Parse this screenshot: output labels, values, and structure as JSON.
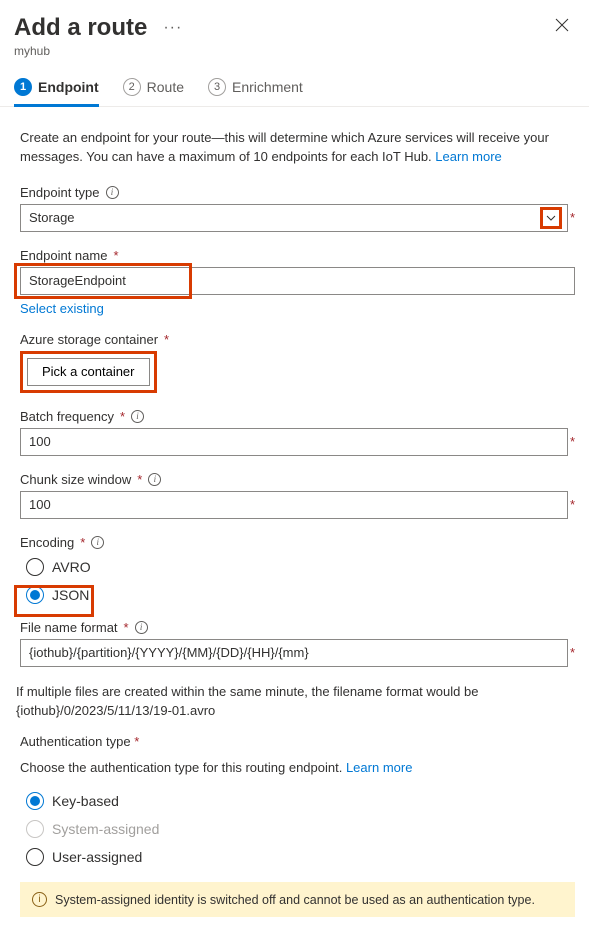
{
  "header": {
    "title": "Add a route",
    "subtitle": "myhub"
  },
  "stepper": {
    "steps": [
      {
        "num": "1",
        "label": "Endpoint"
      },
      {
        "num": "2",
        "label": "Route"
      },
      {
        "num": "3",
        "label": "Enrichment"
      }
    ]
  },
  "intro": {
    "text": "Create an endpoint for your route—this will determine which Azure services will receive your messages. You can have a maximum of 10 endpoints for each IoT Hub. ",
    "link": "Learn more"
  },
  "form": {
    "endpoint_type": {
      "label": "Endpoint type",
      "value": "Storage"
    },
    "endpoint_name": {
      "label": "Endpoint name",
      "value": "StorageEndpoint",
      "select_existing": "Select existing"
    },
    "container": {
      "label": "Azure storage container",
      "button": "Pick a container"
    },
    "batch_freq": {
      "label": "Batch frequency",
      "value": "100"
    },
    "chunk_size": {
      "label": "Chunk size window",
      "value": "100"
    },
    "encoding": {
      "label": "Encoding",
      "options": [
        {
          "label": "AVRO",
          "checked": false
        },
        {
          "label": "JSON",
          "checked": true
        }
      ]
    },
    "file_format": {
      "label": "File name format",
      "value": "{iothub}/{partition}/{YYYY}/{MM}/{DD}/{HH}/{mm}",
      "helper": "If multiple files are created within the same minute, the filename format would be {iothub}/0/2023/5/11/13/19-01.avro"
    },
    "auth": {
      "label": "Authentication type",
      "desc": "Choose the authentication type for this routing endpoint. ",
      "desc_link": "Learn more",
      "options": [
        {
          "label": "Key-based",
          "checked": true,
          "disabled": false
        },
        {
          "label": "System-assigned",
          "checked": false,
          "disabled": true
        },
        {
          "label": "User-assigned",
          "checked": false,
          "disabled": false
        }
      ],
      "alert": "System-assigned identity is switched off and cannot be used as an authentication type."
    }
  }
}
